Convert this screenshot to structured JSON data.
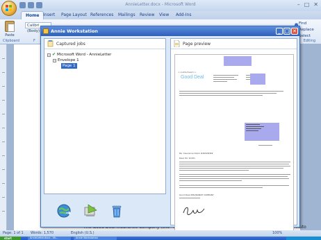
{
  "word": {
    "title": "AnnieLetter.docx - Microsoft Word",
    "tabs": [
      "Home",
      "Insert",
      "Page Layout",
      "References",
      "Mailings",
      "Review",
      "View",
      "Add-Ins"
    ],
    "font_name": "Calibri (Body)",
    "paste_label": "Paste",
    "clipboard_label": "Clipboard",
    "font_group_label": "F",
    "find_label": "Find",
    "replace_label": "Replace",
    "select_label": "Select",
    "editing_label": "Editing",
    "doc_text": "The Good Deal Insurance Company (the \"Company\") agrees to reconsider the cancellation of your Auto"
  },
  "dialog": {
    "title": "Annie Workstation",
    "captured_label": "Captured jobs",
    "preview_label": "Page preview",
    "tree": {
      "root": "Microsoft Word - AnnieLetter",
      "child": "Envelope 1",
      "leaf": "Page 1"
    },
    "preview": {
      "company": "Good Deal",
      "header_tag": "<<Letterhead>>",
      "salutation": "Dear Mr. Smith:",
      "re": "Re: Insurance Claim #######",
      "closing": "Good Deal INSURANCE COMPANY"
    }
  },
  "status": {
    "page": "Page: 1 of 1",
    "words": "Words: 1,570",
    "lang": "English (U.S.)",
    "zoom": "100%"
  },
  "taskbar": {
    "start": "start",
    "item1": "AnnieLetter.docx - Mi...",
    "item2": "Annie Workstation"
  },
  "colors": {
    "dialog_title": "#2e5fb9",
    "selection": "#316ac5",
    "preview_purple": "#a9a9ee"
  }
}
